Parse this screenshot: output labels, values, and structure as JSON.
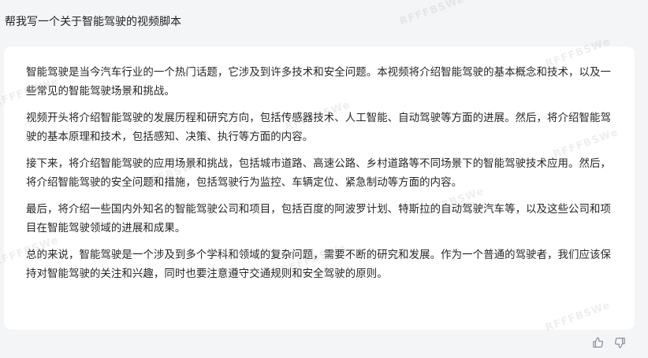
{
  "prompt": "帮我写一个关于智能驾驶的视频脚本",
  "response": {
    "paragraphs": [
      "智能驾驶是当今汽车行业的一个热门话题，它涉及到许多技术和安全问题。本视频将介绍智能驾驶的基本概念和技术，以及一些常见的智能驾驶场景和挑战。",
      "视频开头将介绍智能驾驶的发展历程和研究方向，包括传感器技术、人工智能、自动驾驶等方面的进展。然后，将介绍智能驾驶的基本原理和技术，包括感知、决策、执行等方面的内容。",
      "接下来，将介绍智能驾驶的应用场景和挑战，包括城市道路、高速公路、乡村道路等不同场景下的智能驾驶技术应用。然后，将介绍智能驾驶的安全问题和措施，包括驾驶行为监控、车辆定位、紧急制动等方面的内容。",
      "最后，将介绍一些国内外知名的智能驾驶公司和项目，包括百度的阿波罗计划、特斯拉的自动驾驶汽车等，以及这些公司和项目在智能驾驶领域的进展和成果。",
      "总的来说，智能驾驶是一个涉及到多个学科和领域的复杂问题，需要不断的研究和发展。作为一个普通的驾驶者，我们应该保持对智能驾驶的关注和兴趣，同时也要注意遵守交通规则和安全驾驶的原则。"
    ]
  },
  "feedback": {
    "like_icon": "thumbs-up-icon",
    "dislike_icon": "thumbs-down-icon"
  },
  "watermark": "RFFFBSWe",
  "colors": {
    "page_bg": "#f4f5f7",
    "card_bg": "#ffffff",
    "text": "#262626",
    "icon": "#8a8f99"
  }
}
